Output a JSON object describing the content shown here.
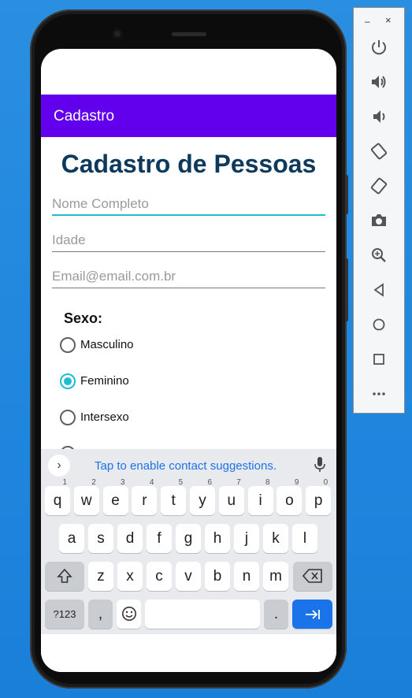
{
  "app": {
    "appbar_title": "Cadastro",
    "page_title": "Cadastro de Pessoas",
    "fields": [
      {
        "placeholder": "Nome Completo",
        "value": ""
      },
      {
        "placeholder": "Idade",
        "value": ""
      },
      {
        "placeholder": "Email@email.com.br",
        "value": ""
      }
    ],
    "sexo_label": "Sexo:",
    "radios": [
      {
        "label": "Masculino",
        "checked": false
      },
      {
        "label": "Feminino",
        "checked": true
      },
      {
        "label": "Intersexo",
        "checked": false
      }
    ],
    "accent_color": "#6200ee",
    "focus_color": "#20bcd0"
  },
  "keyboard": {
    "suggestion": "Tap to enable contact suggestions.",
    "row1": [
      {
        "k": "q",
        "n": "1"
      },
      {
        "k": "w",
        "n": "2"
      },
      {
        "k": "e",
        "n": "3"
      },
      {
        "k": "r",
        "n": "4"
      },
      {
        "k": "t",
        "n": "5"
      },
      {
        "k": "y",
        "n": "6"
      },
      {
        "k": "u",
        "n": "7"
      },
      {
        "k": "i",
        "n": "8"
      },
      {
        "k": "o",
        "n": "9"
      },
      {
        "k": "p",
        "n": "0"
      }
    ],
    "row2": [
      "a",
      "s",
      "d",
      "f",
      "g",
      "h",
      "j",
      "k",
      "l"
    ],
    "row3": [
      "z",
      "x",
      "c",
      "v",
      "b",
      "n",
      "m"
    ],
    "symbols_label": "?123",
    "comma_label": ",",
    "period_label": ".",
    "emoji_icon": "emoji-icon",
    "enter_icon": "tab-next-icon",
    "shift_icon": "shift-icon",
    "backspace_icon": "backspace-icon"
  },
  "emulator_toolbar": {
    "minimize_label": "–",
    "close_label": "×",
    "icons": [
      "power-icon",
      "volume-up-icon",
      "volume-down-icon",
      "rotate-left-icon",
      "rotate-right-icon",
      "camera-icon",
      "zoom-icon",
      "back-icon",
      "home-icon",
      "overview-icon",
      "more-icon"
    ]
  }
}
